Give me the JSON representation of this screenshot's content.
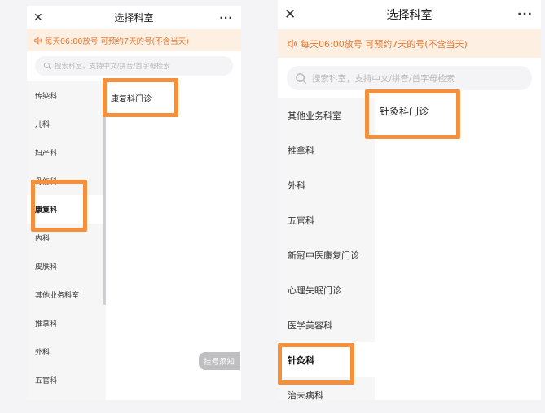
{
  "left": {
    "header": {
      "close": "✕",
      "title": "选择科室",
      "more": "···"
    },
    "notice": "每天06:00放号 可预约7天的号(不含当天)",
    "search": {
      "placeholder": "搜索科室，支持中文/拼音/首字母检索"
    },
    "sidebar": [
      {
        "label": "传染科",
        "active": false
      },
      {
        "label": "儿科",
        "active": false
      },
      {
        "label": "妇产科",
        "active": false
      },
      {
        "label": "骨伤科",
        "active": false
      },
      {
        "label": "康复科",
        "active": true
      },
      {
        "label": "内科",
        "active": false
      },
      {
        "label": "皮肤科",
        "active": false
      },
      {
        "label": "其他业务科室",
        "active": false
      },
      {
        "label": "推拿科",
        "active": false
      },
      {
        "label": "外科",
        "active": false
      },
      {
        "label": "五官科",
        "active": false
      }
    ],
    "sub_items": [
      "康复科门诊"
    ],
    "notice_tag": "挂号须知"
  },
  "right": {
    "header": {
      "close": "✕",
      "title": "选择科室",
      "more": "···"
    },
    "notice": "每天06:00放号 可预约7天的号(不含当天)",
    "search": {
      "placeholder": "搜索科室，支持中文/拼音/首字母检索"
    },
    "sidebar": [
      {
        "label": "其他业务科室",
        "active": false
      },
      {
        "label": "推拿科",
        "active": false
      },
      {
        "label": "外科",
        "active": false
      },
      {
        "label": "五官科",
        "active": false
      },
      {
        "label": "新冠中医康复门诊",
        "active": false
      },
      {
        "label": "心理失眠门诊",
        "active": false
      },
      {
        "label": "医学美容科",
        "active": false
      },
      {
        "label": "针灸科",
        "active": true
      },
      {
        "label": "治未病科",
        "active": false
      }
    ],
    "sub_items": [
      "针灸科门诊"
    ]
  },
  "colors": {
    "accent_orange": "#f3903e",
    "notice_text": "#e8772e",
    "notice_bg": "#fdf0e3"
  }
}
